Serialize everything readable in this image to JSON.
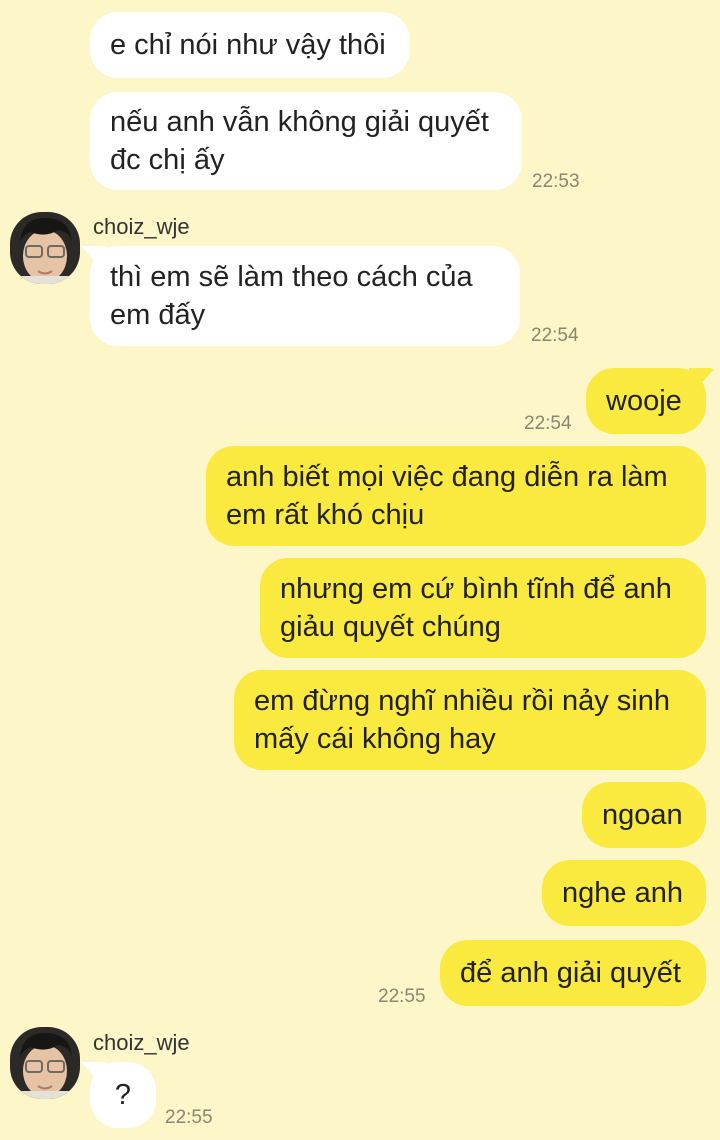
{
  "contact": {
    "name": "choiz_wje"
  },
  "messages": [
    {
      "text": "e chỉ nói như vậy thôi"
    },
    {
      "text": "nếu anh vẫn không giải quyết đc chị ấy",
      "time": "22:53"
    },
    {
      "text": "thì em sẽ làm theo cách của em đấy",
      "time": "22:54"
    },
    {
      "text": "wooje",
      "time": "22:54"
    },
    {
      "text": "anh biết mọi việc đang diễn ra làm em rất khó chịu"
    },
    {
      "text": "nhưng em cứ bình tĩnh để anh giảu quyết chúng"
    },
    {
      "text": "em đừng nghĩ nhiều rồi nảy sinh mấy cái không hay"
    },
    {
      "text": "ngoan"
    },
    {
      "text": "nghe anh"
    },
    {
      "text": "để anh giải quyết",
      "time": "22:55"
    },
    {
      "text": "?",
      "time": "22:55"
    }
  ],
  "colors": {
    "background": "#fdf6c9",
    "incoming_bubble": "#ffffff",
    "outgoing_bubble": "#fae93e",
    "timestamp": "#8a8670"
  },
  "icons": {
    "avatar": "profile-photo-avatar"
  }
}
